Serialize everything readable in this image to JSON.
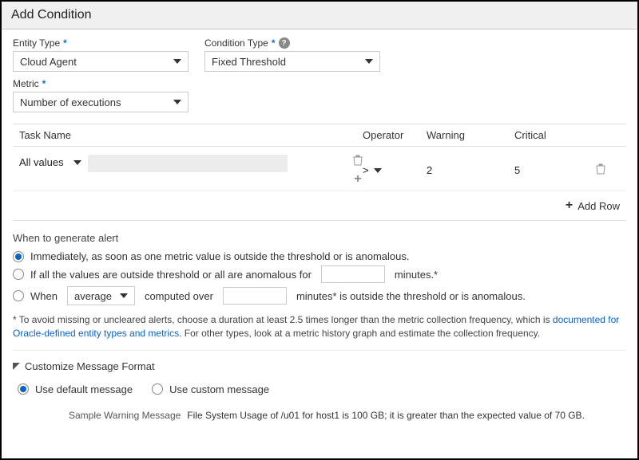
{
  "header": {
    "title": "Add Condition"
  },
  "form": {
    "entity_type_label": "Entity Type",
    "entity_type_value": "Cloud Agent",
    "condition_type_label": "Condition Type",
    "condition_type_value": "Fixed Threshold",
    "metric_label": "Metric",
    "metric_value": "Number of executions"
  },
  "table": {
    "headers": {
      "task": "Task Name",
      "operator": "Operator",
      "warning": "Warning",
      "critical": "Critical"
    },
    "rows": [
      {
        "task_selector": "All values",
        "operator": ">",
        "warning": "2",
        "critical": "5"
      }
    ],
    "add_row_label": "Add Row"
  },
  "when": {
    "section_label": "When to generate alert",
    "opt_immediate": "Immediately, as soon as one metric value is outside the threshold or is anomalous.",
    "opt_allvalues_prefix": "If all the values are outside threshold or all are anomalous for",
    "opt_allvalues_suffix": "minutes.*",
    "opt_when_prefix": "When",
    "opt_when_agg": "average",
    "opt_when_mid": "computed over",
    "opt_when_suffix": "minutes* is outside the threshold or is anomalous.",
    "note_prefix": "* To avoid missing or uncleared alerts, choose a duration at least 2.5 times longer than the metric collection frequency, which is ",
    "note_link": "documented for Oracle-defined entity types and metrics",
    "note_suffix": ". For other types, look at a metric history graph and estimate the collection frequency."
  },
  "message": {
    "section_label": "Customize Message Format",
    "use_default": "Use default message",
    "use_custom": "Use custom message",
    "sample_label": "Sample Warning Message",
    "sample_text": "File System Usage of /u01 for host1 is 100 GB; it is greater than the expected value of 70 GB."
  }
}
